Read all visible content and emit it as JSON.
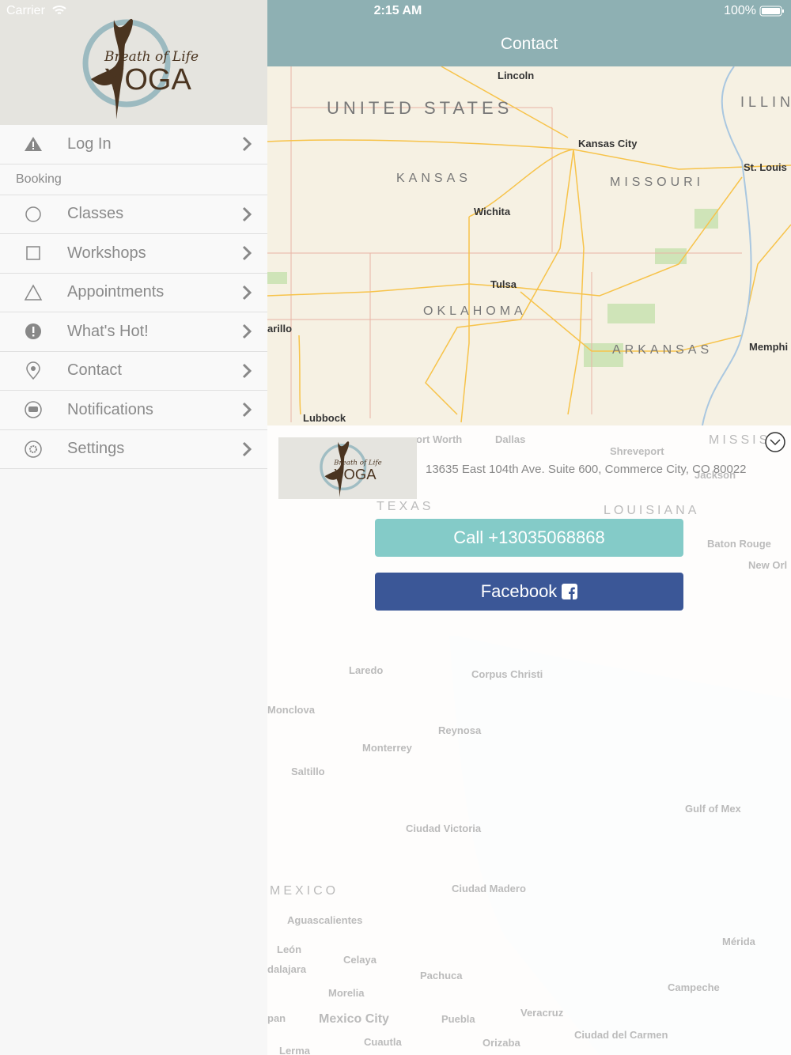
{
  "status_bar": {
    "carrier": "Carrier",
    "time": "2:15 AM",
    "battery": "100%"
  },
  "sidebar": {
    "logo_text": {
      "line1": "Breath of Life",
      "line2": "YOGA"
    },
    "login": {
      "label": "Log In",
      "icon": "warning-icon"
    },
    "section": "Booking",
    "items": [
      {
        "label": "Classes",
        "icon": "circle-icon"
      },
      {
        "label": "Workshops",
        "icon": "square-icon"
      },
      {
        "label": "Appointments",
        "icon": "triangle-icon"
      },
      {
        "label": "What's Hot!",
        "icon": "exclamation-icon"
      },
      {
        "label": "Contact",
        "icon": "location-star-icon"
      },
      {
        "label": "Notifications",
        "icon": "chat-bubble-icon"
      },
      {
        "label": "Settings",
        "icon": "gear-icon"
      }
    ]
  },
  "header": {
    "title": "Contact"
  },
  "map": {
    "cities": [
      "Lincoln",
      "Kansas City",
      "St. Louis",
      "Wichita",
      "Tulsa",
      "Memphi",
      "arillo",
      "Lubbock"
    ],
    "states": [
      "UNITED STATES",
      "ILLINO",
      "KANSAS",
      "MISSOURI",
      "OKLAHOMA",
      "ARKANSAS"
    ],
    "faded": [
      "ort Worth",
      "Dallas",
      "Shreveport",
      "MISSIS",
      "Jackson",
      "TEXAS",
      "LOUISIANA",
      "Baton Rouge",
      "New Orl",
      "Laredo",
      "Corpus Christi",
      "Reynosa",
      "Monclova",
      "Monterrey",
      "Saltillo",
      "Gulf of Mex",
      "Ciudad Victoria",
      "MEXICO",
      "Ciudad Madero",
      "Aguascalientes",
      "León",
      "Celaya",
      "Mérida",
      "dalajara",
      "Pachuca",
      "Campeche",
      "Morelia",
      "pan",
      "Mexico City",
      "Puebla",
      "Veracruz",
      "Cuautla",
      "Orizaba",
      "Ciudad del Carmen",
      "Lerma"
    ]
  },
  "contact": {
    "address": "13635 East 104th Ave. Suite 600, Commerce City, CO 80022",
    "call_label": "Call +13035068868",
    "facebook_label": "Facebook",
    "call_color": "#84cbc8",
    "facebook_color": "#3b5797"
  }
}
